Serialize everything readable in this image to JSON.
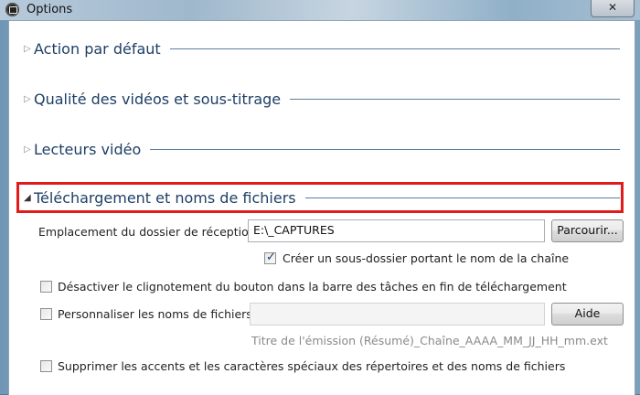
{
  "window": {
    "title": "Options",
    "close_glyph": "✕"
  },
  "sections": [
    {
      "label": "Action par défaut",
      "expanded": false
    },
    {
      "label": "Qualité des vidéos et sous-titrage",
      "expanded": false
    },
    {
      "label": "Lecteurs vidéo",
      "expanded": false
    },
    {
      "label": "Téléchargement et noms de fichiers",
      "expanded": true
    }
  ],
  "download": {
    "folder_label": "Emplacement du dossier de réception :",
    "folder_value": "E:\\_CAPTURES",
    "browse_label": "Parcourir...",
    "subfolder_label": "Créer un sous-dossier portant le nom de la chaîne",
    "subfolder_checked": true,
    "blink_label": "Désactiver le clignotement du bouton dans la barre des tâches en fin de téléchargement",
    "blink_checked": false,
    "custom_names_label": "Personnaliser les noms de fichiers :",
    "custom_names_checked": false,
    "custom_names_value": "",
    "help_label": "Aide",
    "pattern_hint": "Titre de l'émission (Résumé)_Chaîne_AAAA_MM_JJ_HH_mm.ext",
    "accents_label": "Supprimer les accents et les caractères spéciaux des répertoires et des noms de fichiers",
    "accents_checked": false
  },
  "colors": {
    "section_title": "#1e3f66",
    "highlight_border": "#e21a1a"
  },
  "icons": {
    "collapsed": "▷",
    "expanded": "◢"
  }
}
